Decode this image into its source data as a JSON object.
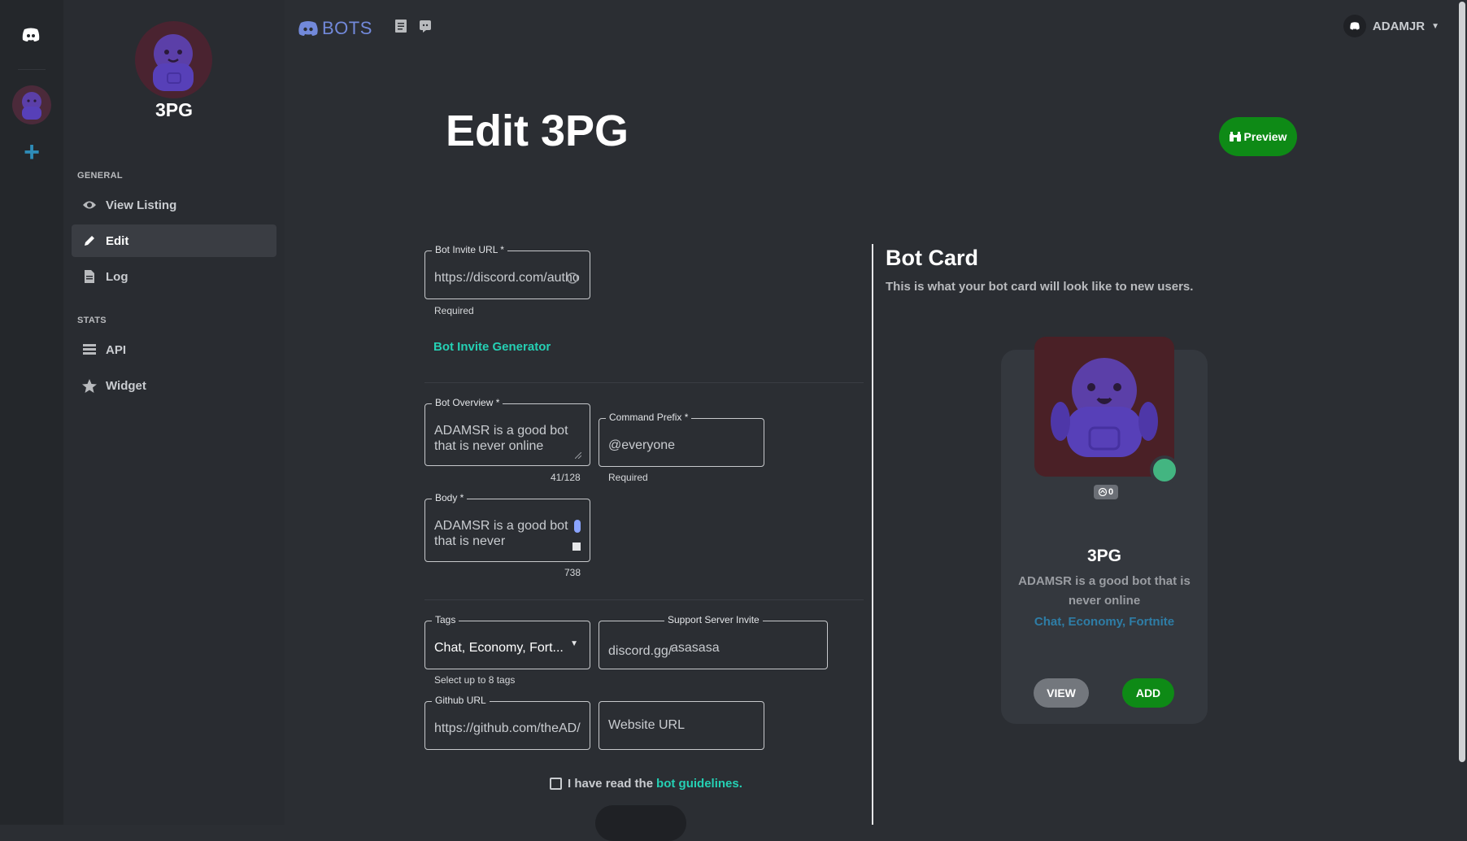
{
  "brand": {
    "name": "BOTS"
  },
  "user": {
    "name": "ADAMJR"
  },
  "sidebar": {
    "bot_name": "3PG",
    "sections": {
      "general": "GENERAL",
      "stats": "STATS"
    },
    "items": [
      {
        "label": "View Listing",
        "icon": "eye-icon"
      },
      {
        "label": "Edit",
        "icon": "pencil-icon",
        "active": true
      },
      {
        "label": "Log",
        "icon": "file-icon"
      },
      {
        "label": "API",
        "icon": "list-icon"
      },
      {
        "label": "Widget",
        "icon": "star-icon"
      }
    ]
  },
  "page": {
    "title": "Edit 3PG",
    "preview_label": "Preview"
  },
  "form": {
    "invite": {
      "label": "Bot Invite URL *",
      "value": "https://discord.com/autho",
      "helper": "Required",
      "generator_link": "Bot Invite Generator"
    },
    "overview": {
      "label": "Bot Overview *",
      "value_line1": "ADAMSR is a good bot",
      "value_line2": "that is never online",
      "counter": "41/128"
    },
    "prefix": {
      "label": "Command Prefix *",
      "value": "@everyone",
      "helper": "Required"
    },
    "body": {
      "label": "Body *",
      "value_line1": "ADAMSR is a good bot",
      "value_line2": "that is never",
      "counter": "738"
    },
    "tags": {
      "label": "Tags",
      "value": "Chat, Economy, Fort...",
      "helper": "Select up to 8 tags"
    },
    "support": {
      "label": "Support Server Invite",
      "prefix": "discord.gg/",
      "value": "asasasa"
    },
    "github": {
      "label": "Github URL",
      "value": "https://github.com/theAD/"
    },
    "website": {
      "placeholder": "Website URL"
    },
    "agree": {
      "text": "I have read the",
      "link": "bot guidelines."
    }
  },
  "card": {
    "title": "Bot Card",
    "subtitle": "This is what your bot card will look like to new users.",
    "votes": "0",
    "name": "3PG",
    "description": "ADAMSR is a good bot that is never online",
    "tags": "Chat, Economy, Fortnite",
    "view_label": "VIEW",
    "add_label": "ADD",
    "status_color": "#43b581"
  },
  "colors": {
    "accent": "#25d0b4",
    "success": "#0e8a16",
    "brand": "#7289da"
  }
}
